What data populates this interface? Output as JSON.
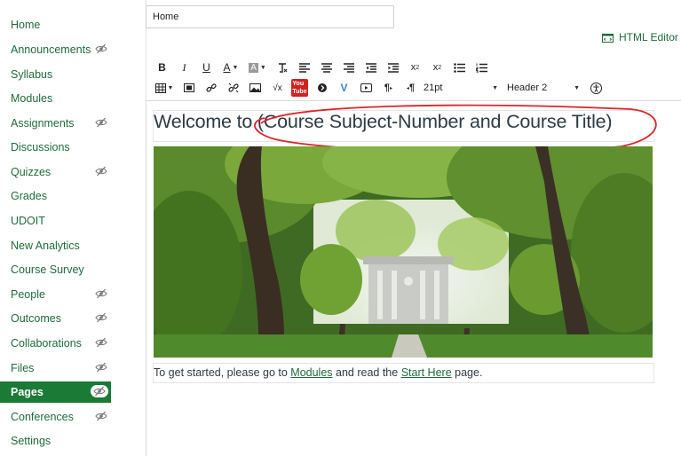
{
  "sidebar": {
    "items": [
      {
        "label": "Home",
        "hidden": false,
        "active": false
      },
      {
        "label": "Announcements",
        "hidden": true,
        "active": false
      },
      {
        "label": "Syllabus",
        "hidden": false,
        "active": false
      },
      {
        "label": "Modules",
        "hidden": false,
        "active": false
      },
      {
        "label": "Assignments",
        "hidden": true,
        "active": false
      },
      {
        "label": "Discussions",
        "hidden": false,
        "active": false
      },
      {
        "label": "Quizzes",
        "hidden": true,
        "active": false
      },
      {
        "label": "Grades",
        "hidden": false,
        "active": false
      },
      {
        "label": "UDOIT",
        "hidden": false,
        "active": false
      },
      {
        "label": "New Analytics",
        "hidden": false,
        "active": false
      },
      {
        "label": "Course Survey",
        "hidden": false,
        "active": false
      },
      {
        "label": "People",
        "hidden": true,
        "active": false
      },
      {
        "label": "Outcomes",
        "hidden": true,
        "active": false
      },
      {
        "label": "Collaborations",
        "hidden": true,
        "active": false
      },
      {
        "label": "Files",
        "hidden": true,
        "active": false
      },
      {
        "label": "Pages",
        "hidden": true,
        "active": true
      },
      {
        "label": "Conferences",
        "hidden": true,
        "active": false
      },
      {
        "label": "Settings",
        "hidden": false,
        "active": false
      }
    ]
  },
  "editor": {
    "title_value": "Home",
    "html_editor_label": "HTML Editor",
    "font_size": "21pt",
    "block_format": "Header 2",
    "heading_text": "Welcome to (Course Subject-Number and Course Title)",
    "body": {
      "prefix": "To get started, please go to ",
      "link1": "Modules",
      "middle": " and read the ",
      "link2": "Start Here",
      "suffix": " page."
    }
  },
  "colors": {
    "accent": "#1b7a36",
    "link": "#1e6b3a",
    "annotation": "#d9262b"
  }
}
